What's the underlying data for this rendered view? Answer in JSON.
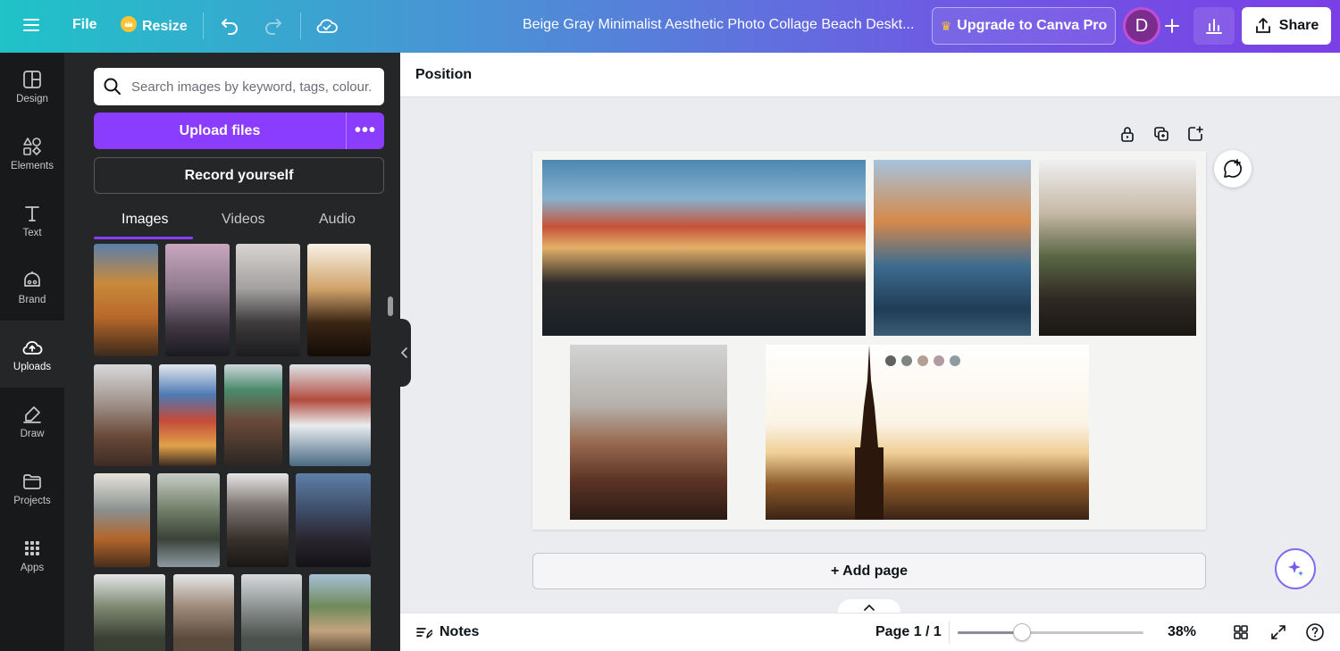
{
  "topbar": {
    "file_label": "File",
    "resize_label": "Resize",
    "doc_title": "Beige Gray Minimalist Aesthetic Photo Collage Beach Deskt...",
    "upgrade_label": "Upgrade to Canva Pro",
    "avatar_initial": "D",
    "share_label": "Share"
  },
  "rail": {
    "items": [
      {
        "label": "Design"
      },
      {
        "label": "Elements"
      },
      {
        "label": "Text"
      },
      {
        "label": "Brand"
      },
      {
        "label": "Uploads"
      },
      {
        "label": "Draw"
      },
      {
        "label": "Projects"
      },
      {
        "label": "Apps"
      }
    ]
  },
  "panel": {
    "search_placeholder": "Search images by keyword, tags, colour...",
    "upload_label": "Upload files",
    "more_label": "•••",
    "record_label": "Record yourself",
    "tabs": [
      {
        "label": "Images"
      },
      {
        "label": "Videos"
      },
      {
        "label": "Audio"
      }
    ]
  },
  "workspace": {
    "position_label": "Position",
    "add_page_label": "+ Add page",
    "palette": [
      "#5e6360",
      "#7f8582",
      "#b59f95",
      "#b29ba3",
      "#8e9ba0"
    ]
  },
  "bottombar": {
    "notes_label": "Notes",
    "page_info": "Page 1 / 1",
    "zoom_label": "38%",
    "zoom_value": 38
  },
  "colors": {
    "accent": "#8b3dff",
    "panel": "#252627",
    "rail": "#18191b"
  }
}
